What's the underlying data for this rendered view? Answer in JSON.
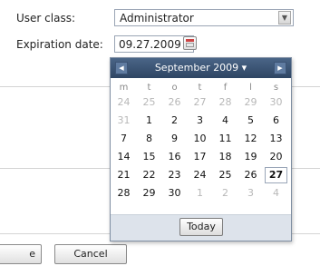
{
  "form": {
    "user_class_label": "User class:",
    "user_class_value": "Administrator",
    "expiration_label": "Expiration date:",
    "expiration_value": "09.27.2009"
  },
  "datepicker": {
    "month_title": "September 2009",
    "dropdown_glyph": "▾",
    "prev_glyph": "◀",
    "next_glyph": "▶",
    "weekdays": [
      "m",
      "t",
      "o",
      "t",
      "f",
      "l",
      "s"
    ],
    "weeks": [
      [
        "24",
        "25",
        "26",
        "27",
        "28",
        "29",
        "30"
      ],
      [
        "31",
        "1",
        "2",
        "3",
        "4",
        "5",
        "6"
      ],
      [
        "7",
        "8",
        "9",
        "10",
        "11",
        "12",
        "13"
      ],
      [
        "14",
        "15",
        "16",
        "17",
        "18",
        "19",
        "20"
      ],
      [
        "21",
        "22",
        "23",
        "24",
        "25",
        "26",
        "27"
      ],
      [
        "28",
        "29",
        "30",
        "1",
        "2",
        "3",
        "4"
      ]
    ],
    "muted_days": [
      [
        0,
        0
      ],
      [
        0,
        1
      ],
      [
        0,
        2
      ],
      [
        0,
        3
      ],
      [
        0,
        4
      ],
      [
        0,
        5
      ],
      [
        0,
        6
      ],
      [
        1,
        0
      ],
      [
        5,
        3
      ],
      [
        5,
        4
      ],
      [
        5,
        5
      ],
      [
        5,
        6
      ]
    ],
    "selected_day": [
      4,
      6
    ],
    "today_button": "Today"
  },
  "actions": {
    "ok_partial": "e",
    "cancel_label": "Cancel"
  },
  "icons": {
    "select_arrow": "chevron-down-icon",
    "calendar": "calendar-icon"
  }
}
